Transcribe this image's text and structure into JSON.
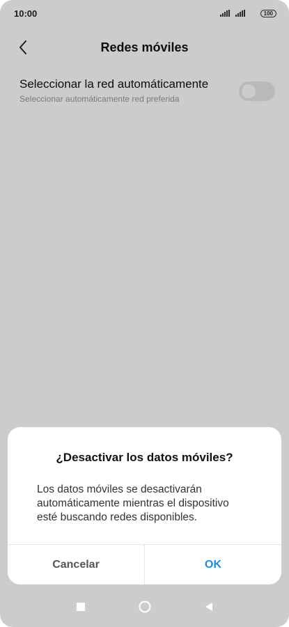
{
  "status_bar": {
    "time": "10:00",
    "battery": "100"
  },
  "app_bar": {
    "title": "Redes móviles"
  },
  "setting": {
    "title": "Seleccionar la red automáticamente",
    "subtitle": "Seleccionar automáticamente red preferida",
    "enabled": false
  },
  "dialog": {
    "title": "¿Desactivar los datos móviles?",
    "message": "Los datos móviles se desactivarán automáticamente mientras el dispositivo esté buscando redes disponibles.",
    "cancel_label": "Cancelar",
    "ok_label": "OK"
  },
  "colors": {
    "accent": "#1a8fe0",
    "scrim": "#000000"
  }
}
